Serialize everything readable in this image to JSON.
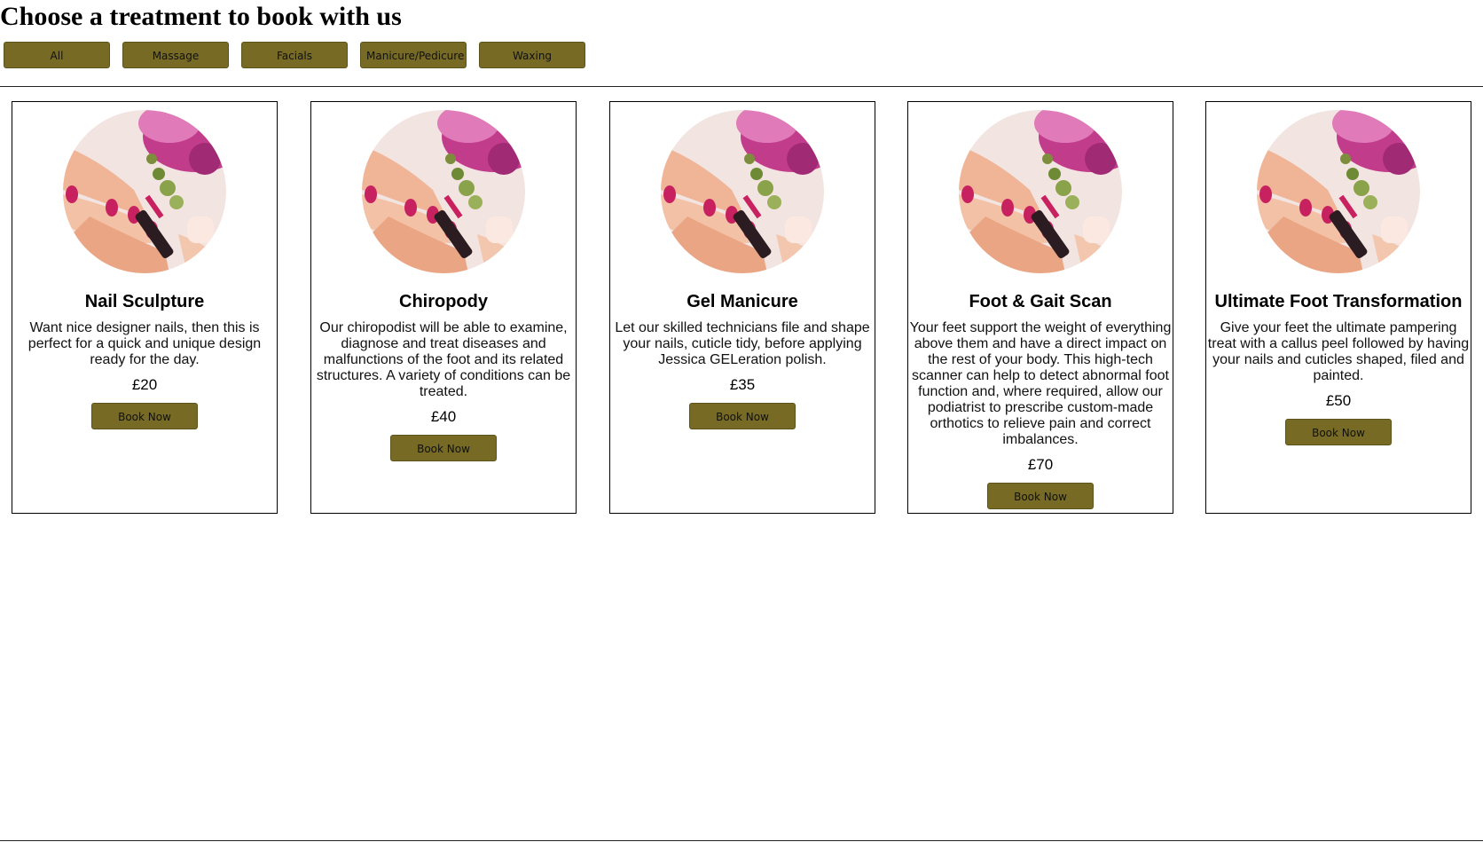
{
  "page": {
    "title": "Choose a treatment to book with us"
  },
  "colors": {
    "button_background": "#766a25",
    "button_border": "#5c531c",
    "card_border": "#000000",
    "divider": "#222222"
  },
  "filters": [
    {
      "label": "All"
    },
    {
      "label": "Massage"
    },
    {
      "label": "Facials"
    },
    {
      "label": "Manicure/Pedicure"
    },
    {
      "label": "Waxing"
    }
  ],
  "treatments": [
    {
      "image_icon": "manicure-photo",
      "name": "Nail Sculpture",
      "description": "Want nice designer nails, then this is perfect for a quick and unique design ready for the day.",
      "price": "£20",
      "button_label": "Book Now"
    },
    {
      "image_icon": "manicure-photo",
      "name": "Chiropody",
      "description": "Our chiropodist will be able to examine, diagnose and treat diseases and malfunctions of the foot and its related structures. A variety of conditions can be treated.",
      "price": "£40",
      "button_label": "Book Now"
    },
    {
      "image_icon": "manicure-photo",
      "name": "Gel Manicure",
      "description": "Let our skilled technicians file and shape your nails, cuticle tidy, before applying Jessica GELeration polish.",
      "price": "£35",
      "button_label": "Book Now"
    },
    {
      "image_icon": "manicure-photo",
      "name": "Foot & Gait Scan",
      "description": "Your feet support the weight of everything above them and have a direct impact on the rest of your body. This high-tech scanner can help to detect abnormal foot function and, where required, allow our podiatrist to prescribe custom-made orthotics to relieve pain and correct imbalances.",
      "price": "£70",
      "button_label": "Book Now"
    },
    {
      "image_icon": "manicure-photo",
      "name": "Ultimate Foot Transformation",
      "description": "Give your feet the ultimate pampering treat with a callus peel followed by having your nails and cuticles shaped, filed and painted.",
      "price": "£50",
      "button_label": "Book Now"
    }
  ]
}
